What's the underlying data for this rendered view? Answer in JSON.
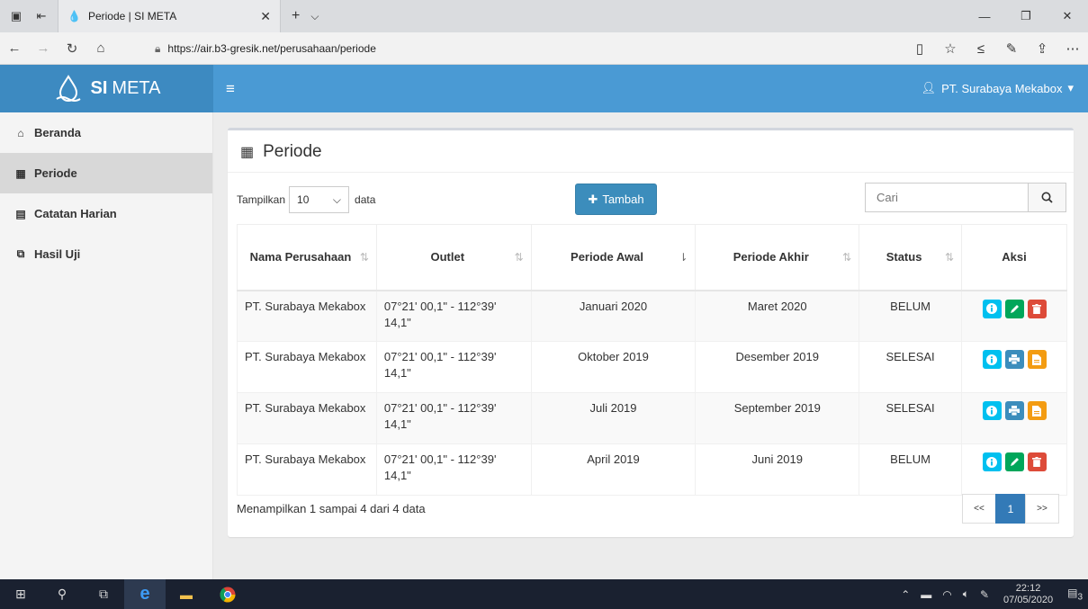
{
  "browser": {
    "tab_title": "Periode | SI META",
    "url": "https://air.b3-gresik.net/perusahaan/periode"
  },
  "app": {
    "brand_si": "SI",
    "brand_meta": "META",
    "user": "PT. Surabaya Mekabox",
    "accent": "#3c8dbc"
  },
  "sidebar": {
    "items": [
      {
        "label": "Beranda",
        "icon": "home-icon"
      },
      {
        "label": "Periode",
        "icon": "calendar-icon"
      },
      {
        "label": "Catatan Harian",
        "icon": "file-icon"
      },
      {
        "label": "Hasil Uji",
        "icon": "copy-icon"
      }
    ]
  },
  "page": {
    "title": "Periode",
    "length_prefix": "Tampilkan",
    "length_value": "10",
    "length_suffix": "data",
    "add_label": "Tambah",
    "search_placeholder": "Cari",
    "columns": [
      "Nama Perusahaan",
      "Outlet",
      "Periode Awal",
      "Periode Akhir",
      "Status",
      "Aksi"
    ],
    "rows": [
      {
        "company": "PT. Surabaya Mekabox",
        "outlet": "07°21' 00,1\" - 112°39' 14,1\"",
        "start": "Januari 2020",
        "end": "Maret 2020",
        "status": "BELUM"
      },
      {
        "company": "PT. Surabaya Mekabox",
        "outlet": "07°21' 00,1\" - 112°39' 14,1\"",
        "start": "Oktober 2019",
        "end": "Desember 2019",
        "status": "SELESAI"
      },
      {
        "company": "PT. Surabaya Mekabox",
        "outlet": "07°21' 00,1\" - 112°39' 14,1\"",
        "start": "Juli 2019",
        "end": "September 2019",
        "status": "SELESAI"
      },
      {
        "company": "PT. Surabaya Mekabox",
        "outlet": "07°21' 00,1\" - 112°39' 14,1\"",
        "start": "April 2019",
        "end": "Juni 2019",
        "status": "BELUM"
      }
    ],
    "info": "Menampilkan 1 sampai 4 dari 4 data",
    "pager": {
      "prev": "<<",
      "current": "1",
      "next": ">>"
    }
  },
  "taskbar": {
    "time": "22:12",
    "date": "07/05/2020",
    "notif_count": "3"
  }
}
